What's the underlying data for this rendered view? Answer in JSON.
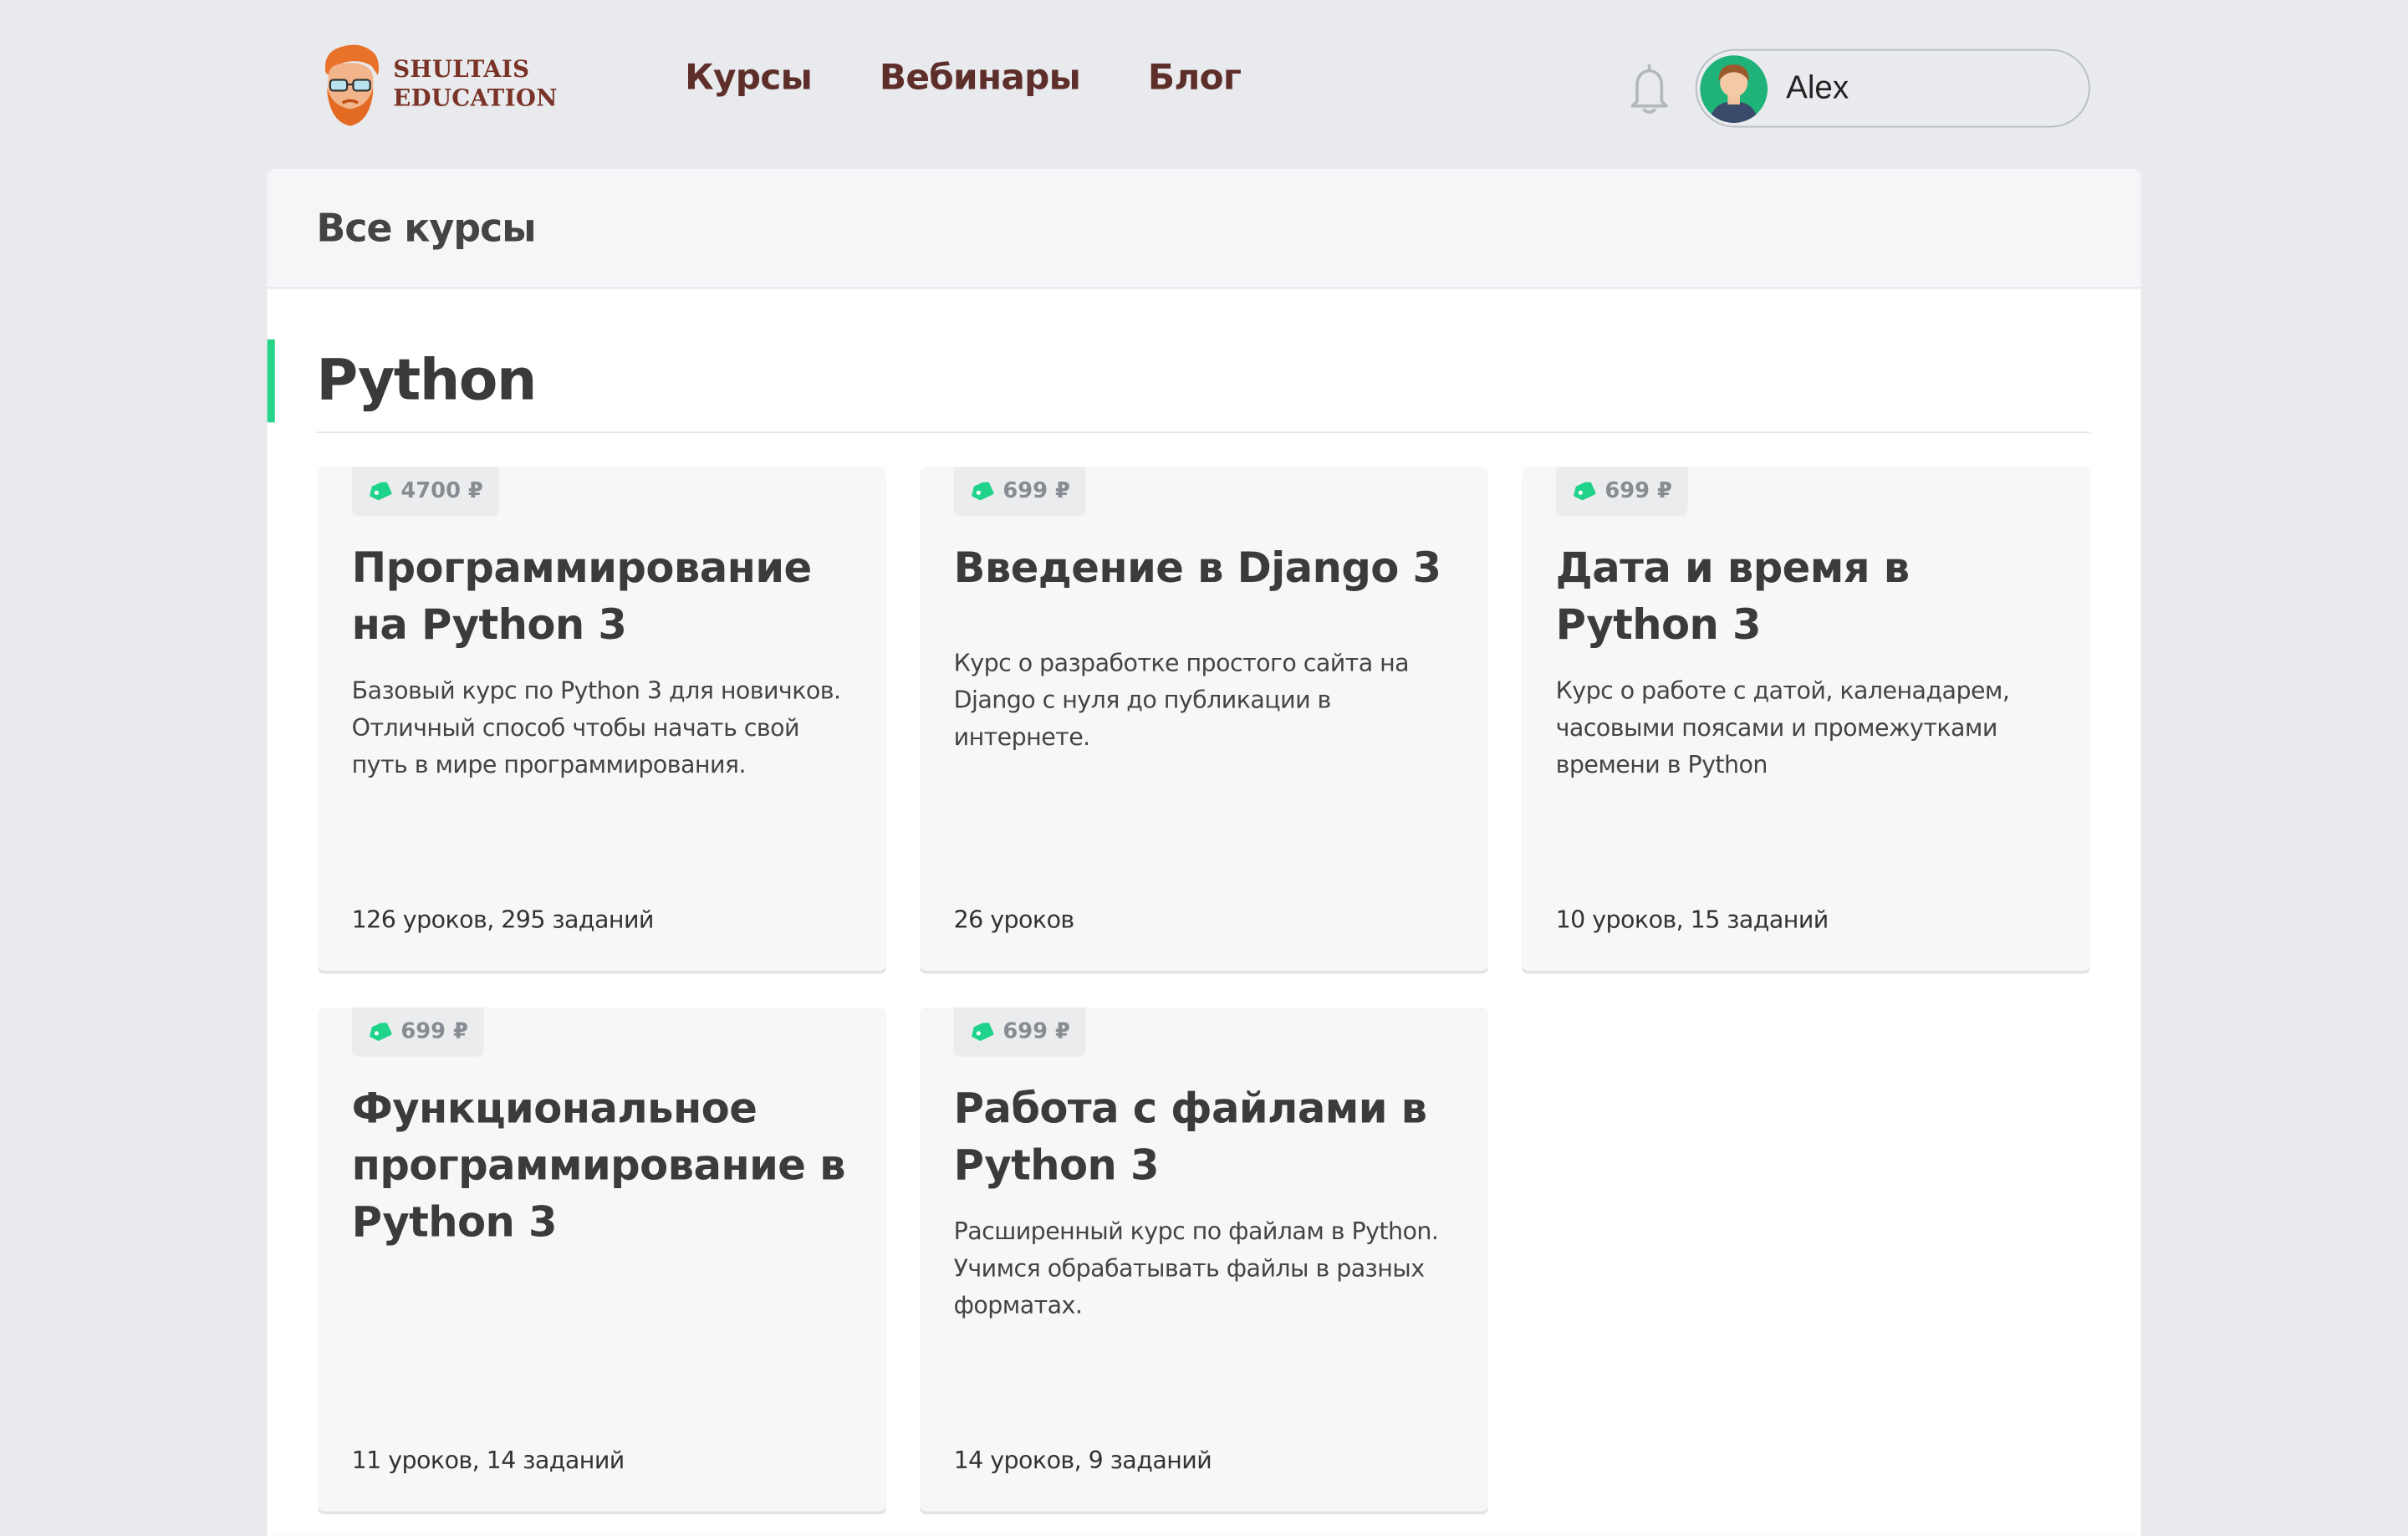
{
  "brand": {
    "line1": "SHULTAIS",
    "line2": "EDUCATION"
  },
  "nav": [
    {
      "label": "Курсы"
    },
    {
      "label": "Вебинары"
    },
    {
      "label": "Блог"
    }
  ],
  "user": {
    "name": "Alex"
  },
  "page": {
    "title": "Все курсы"
  },
  "section": {
    "title": "Python"
  },
  "colors": {
    "accent": "#26d58a",
    "nav_text": "#5e2e2a",
    "brand_text": "#7a3326"
  },
  "courses": [
    {
      "price": "4700 ₽",
      "title": "Программирование на Python 3",
      "description": "Базовый курс по Python 3 для новичков. Отличный способ чтобы начать свой путь в мире программирования.",
      "meta": "126 уроков, 295 заданий"
    },
    {
      "price": "699 ₽",
      "title": "Введение в Django 3",
      "description": "Курс о разработке простого сайта на Django с нуля до публикации в интернете.",
      "meta": "26 уроков"
    },
    {
      "price": "699 ₽",
      "title": "Дата и время в Python 3",
      "description": "Курс о работе с датой, каленадарем, часовыми поясами и промежутками времени в Python",
      "meta": "10 уроков, 15 заданий"
    },
    {
      "price": "699 ₽",
      "title": "Функциональное программирование в Python 3",
      "description": "",
      "meta": "11 уроков, 14 заданий"
    },
    {
      "price": "699 ₽",
      "title": "Работа с файлами в Python 3",
      "description": "Расширенный курс по файлам в Python. Учимся обрабатывать файлы в разных форматах.",
      "meta": "14 уроков, 9 заданий"
    }
  ]
}
